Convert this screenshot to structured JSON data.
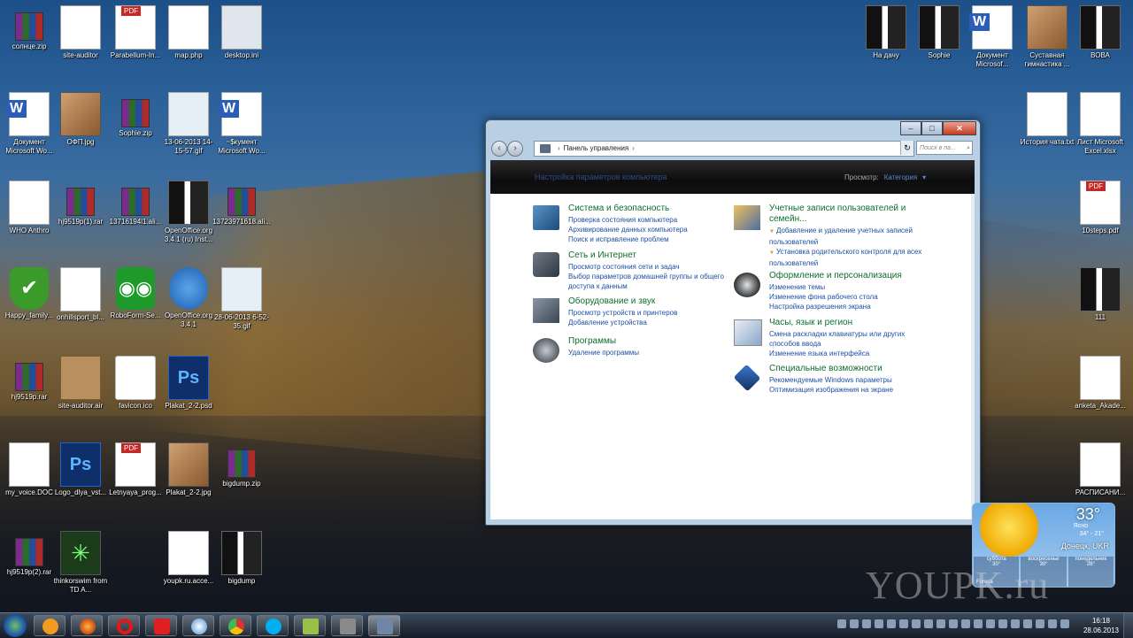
{
  "desktop": {
    "icons_left": [
      {
        "label": "солнце.zip",
        "icon": "rar-archive-icon"
      },
      {
        "label": "site-auditor",
        "icon": "cursor-shortcut-icon"
      },
      {
        "label": "Parabellum-In...",
        "icon": "pdf-icon"
      },
      {
        "label": "map.php",
        "icon": "php-file-icon"
      },
      {
        "label": "desktop.ini",
        "icon": "ini-file-icon"
      },
      {
        "label": "Документ Microsoft Wo...",
        "icon": "word-doc-icon"
      },
      {
        "label": "ОФП.jpg",
        "icon": "image-icon"
      },
      {
        "label": "Sophie.zip",
        "icon": "rar-archive-icon"
      },
      {
        "label": "13-06-2013 14-15-57.gif",
        "icon": "gif-icon"
      },
      {
        "label": "~$кумент Microsoft Wo...",
        "icon": "word-doc-icon"
      },
      {
        "label": "WHO Anthro",
        "icon": "app-shortcut-icon"
      },
      {
        "label": "hj9519p(1).rar",
        "icon": "rar-archive-icon"
      },
      {
        "label": "13716194l1.ali...",
        "icon": "rar-archive-icon"
      },
      {
        "label": "OpenOffice.org 3.4.1 (ru) Inst...",
        "icon": "folder-icon"
      },
      {
        "label": "13723971618.ali...",
        "icon": "rar-archive-icon"
      },
      {
        "label": "Happy_family...",
        "icon": "shield-icon"
      },
      {
        "label": "onhillsport_bl...",
        "icon": "document-icon"
      },
      {
        "label": "RoboForm-Se...",
        "icon": "roboform-icon"
      },
      {
        "label": "OpenOffice.org 3.4.1",
        "icon": "openoffice-icon"
      },
      {
        "label": "28-06-2013 6-52-35.gif",
        "icon": "gif-icon"
      },
      {
        "label": "hj9519p.rar",
        "icon": "rar-archive-icon"
      },
      {
        "label": "site-auditor.air",
        "icon": "air-package-icon"
      },
      {
        "label": "favicon.ico",
        "icon": "ico-file-icon"
      },
      {
        "label": "Plakat_2-2.psd",
        "icon": "psd-icon"
      },
      {
        "label": "my_voice.DOC",
        "icon": "document-icon"
      },
      {
        "label": "Logo_dlya_vst...",
        "icon": "psd-icon"
      },
      {
        "label": "Letnyaya_prog...",
        "icon": "pdf-icon"
      },
      {
        "label": "Plakat_2-2.jpg",
        "icon": "image-icon"
      },
      {
        "label": "bigdump.zip",
        "icon": "rar-archive-icon"
      },
      {
        "label": "hj9519p(2).rar",
        "icon": "rar-archive-icon"
      },
      {
        "label": "thinkorswim from TD A...",
        "icon": "thinkorswim-icon"
      },
      {
        "label": "youpk.ru.acce...",
        "icon": "image-icon"
      },
      {
        "label": "bigdump",
        "icon": "folder-icon"
      }
    ],
    "icons_right": [
      {
        "label": "На дачу",
        "icon": "folder-icon"
      },
      {
        "label": "Sophie",
        "icon": "folder-icon"
      },
      {
        "label": "Документ Microsof...",
        "icon": "word-doc-icon"
      },
      {
        "label": "Суставная гимнастика ...",
        "icon": "video-icon"
      },
      {
        "label": "ВОВА",
        "icon": "folder-icon"
      },
      {
        "label": "История чата.txt",
        "icon": "document-icon"
      },
      {
        "label": "Лист Microsoft Excel.xlsx",
        "icon": "document-icon"
      },
      {
        "label": "10steps.pdf",
        "icon": "pdf-icon"
      },
      {
        "label": "111",
        "icon": "folder-icon"
      },
      {
        "label": "anketa_Akade...",
        "icon": "document-icon"
      },
      {
        "label": "РАСПИСАНИ...",
        "icon": "document-icon"
      }
    ]
  },
  "window": {
    "address": {
      "crumb": "Панель управления",
      "search_placeholder": "Поиск в па..."
    },
    "banner": {
      "title": "Настройка параметров компьютера",
      "view_label": "Просмотр:",
      "view_value": "Категория"
    },
    "categories_left": [
      {
        "title": "Система и безопасность",
        "icon": "system-security-icon",
        "links": [
          "Проверка состояния компьютера",
          "Архивирование данных компьютера",
          "Поиск и исправление проблем"
        ]
      },
      {
        "title": "Сеть и Интернет",
        "icon": "network-icon",
        "links": [
          "Просмотр состояния сети и задач",
          "Выбор параметров домашней группы и общего доступа к данным"
        ]
      },
      {
        "title": "Оборудование и звук",
        "icon": "hardware-sound-icon",
        "links": [
          "Просмотр устройств и принтеров",
          "Добавление устройства"
        ]
      },
      {
        "title": "Программы",
        "icon": "programs-icon",
        "links": [
          "Удаление программы"
        ]
      }
    ],
    "categories_right": [
      {
        "title": "Учетные записи пользователей и семейн...",
        "icon": "user-accounts-icon",
        "links": [
          "Добавление и удаление учетных записей пользователей",
          "Установка родительского контроля для всех пользователей"
        ]
      },
      {
        "title": "Оформление и персонализация",
        "icon": "appearance-icon",
        "links": [
          "Изменение темы",
          "Изменение фона рабочего стола",
          "Настройка разрешения экрана"
        ]
      },
      {
        "title": "Часы, язык и регион",
        "icon": "clock-region-icon",
        "links": [
          "Смена раскладки клавиатуры или других способов ввода",
          "Изменение языка интерфейса"
        ]
      },
      {
        "title": "Специальные возможности",
        "icon": "accessibility-icon",
        "links": [
          "Рекомендуемые Windows параметры",
          "Оптимизация изображения на экране"
        ]
      }
    ]
  },
  "weather": {
    "temp": "33°",
    "condition": "Ясно",
    "range": "34° - 21°",
    "city": "Донецк, UKR",
    "days": [
      "суббота",
      "воскресенье",
      "понедельник"
    ],
    "day_temps": [
      "30°",
      "30°",
      "28°"
    ],
    "source": "Foreca"
  },
  "watermark": "YOUPK.ru",
  "taskbar": {
    "time": "16:18",
    "date": "28.06.2013",
    "pinned": [
      "orb-icon",
      "firefox-icon",
      "opera-icon",
      "yandex-icon",
      "safari-icon",
      "chrome-icon",
      "skype-icon",
      "notes-icon",
      "cpanel-icon",
      "control-panel-icon"
    ]
  }
}
